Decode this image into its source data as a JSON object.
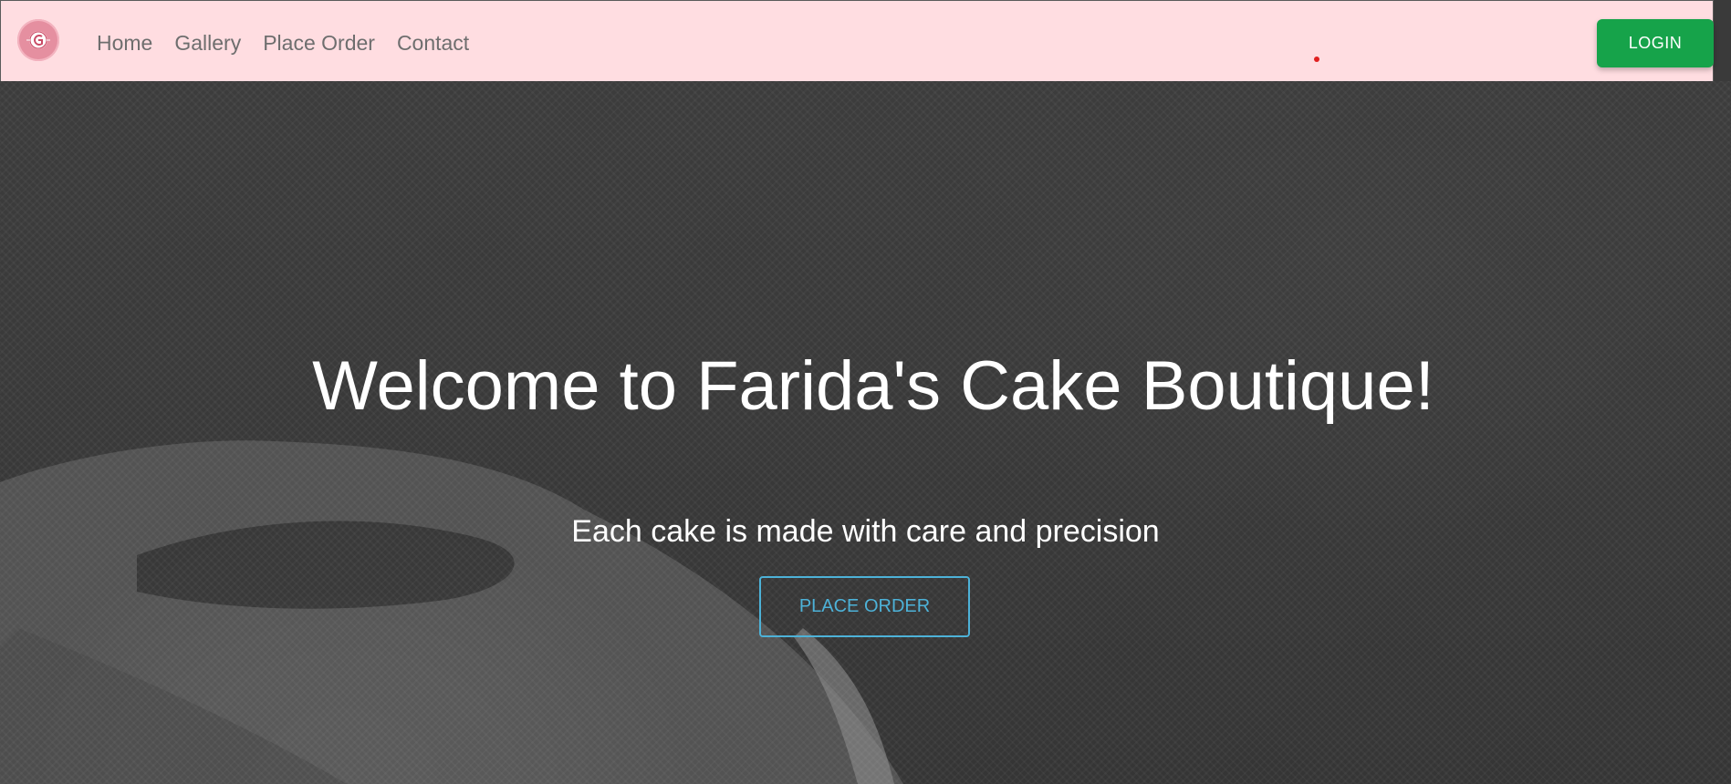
{
  "nav": {
    "logo_alt": "Farida's Cake Boutique logo",
    "items": [
      {
        "label": "Home"
      },
      {
        "label": "Gallery"
      },
      {
        "label": "Place Order"
      },
      {
        "label": "Contact"
      }
    ],
    "login_label": "LOGIN"
  },
  "hero": {
    "title": "Welcome to Farida's Cake Boutique!",
    "subtitle": "Each cake is made with care and precision",
    "cta_label": "PLACE ORDER"
  },
  "colors": {
    "navbar_bg": "#ffdde1",
    "login_bg": "#16a34a",
    "cta_accent": "#4db2d8",
    "nav_text": "#6e6e6e"
  }
}
